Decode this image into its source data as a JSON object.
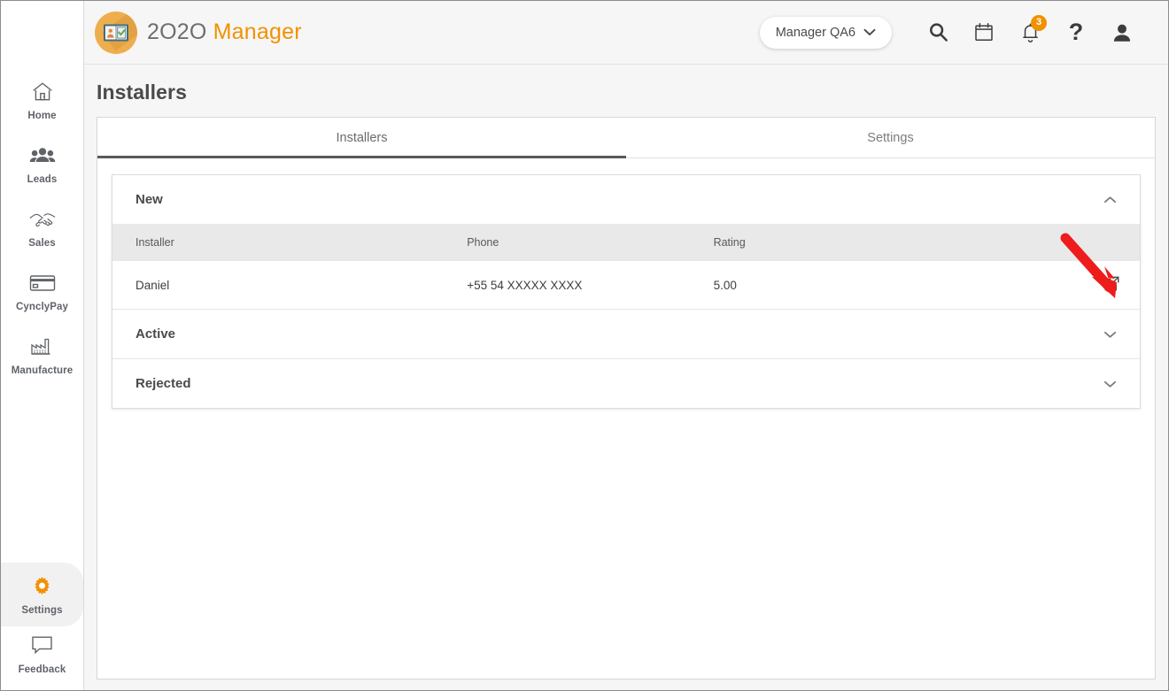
{
  "brand": {
    "name_part1": "2O2O",
    "name_part2": "Manager",
    "logo_icon": "id-card-checklist-icon"
  },
  "topbar": {
    "account": {
      "label": "Manager QA6",
      "chevron_icon": "chevron-down-icon"
    },
    "actions": [
      {
        "name": "search-icon",
        "title": "Search"
      },
      {
        "name": "calendar-icon",
        "title": "Calendar"
      },
      {
        "name": "notifications-bell-icon",
        "title": "Notifications",
        "badge": "3"
      },
      {
        "name": "help-question-icon",
        "title": "Help"
      },
      {
        "name": "user-avatar-icon",
        "title": "Account"
      }
    ]
  },
  "sidebar": {
    "items": [
      {
        "label": "Home",
        "icon": "home-icon",
        "active": false
      },
      {
        "label": "Leads",
        "icon": "people-group-icon",
        "active": false
      },
      {
        "label": "Sales",
        "icon": "handshake-icon",
        "active": false
      },
      {
        "label": "CynclyPay",
        "icon": "credit-card-icon",
        "active": false
      },
      {
        "label": "Manufacture",
        "icon": "factory-icon",
        "active": false
      }
    ],
    "bottom_items": [
      {
        "label": "Settings",
        "icon": "gear-icon",
        "active": true
      },
      {
        "label": "Feedback",
        "icon": "speech-bubble-icon",
        "active": false
      }
    ]
  },
  "page": {
    "title": "Installers"
  },
  "tabs": [
    {
      "label": "Installers",
      "active": true
    },
    {
      "label": "Settings",
      "active": false
    }
  ],
  "groups": [
    {
      "title": "New",
      "expanded": true,
      "chevron_icon": "chevron-up-icon",
      "columns": [
        "Installer",
        "Phone",
        "Rating",
        ""
      ],
      "rows": [
        {
          "installer": "Daniel",
          "phone": "+55 54  XXXXX XXXX",
          "rating": "5.00",
          "action_icon": "external-link-icon"
        }
      ]
    },
    {
      "title": "Active",
      "expanded": false,
      "chevron_icon": "chevron-down-icon",
      "columns": [],
      "rows": []
    },
    {
      "title": "Rejected",
      "expanded": false,
      "chevron_icon": "chevron-down-icon",
      "columns": [],
      "rows": []
    }
  ],
  "annotation": {
    "type": "red-arrow",
    "color": "#ee1c1c",
    "points_to": "external-link-icon"
  },
  "colors": {
    "brand_orange": "#f29100",
    "logo_circle": "#efae4e",
    "badge_orange": "#f29100",
    "annotation_red": "#ee1c1c",
    "tab_underline": "#595959",
    "table_header_bg": "#e9e9e9",
    "page_bg": "#f6f6f6"
  }
}
